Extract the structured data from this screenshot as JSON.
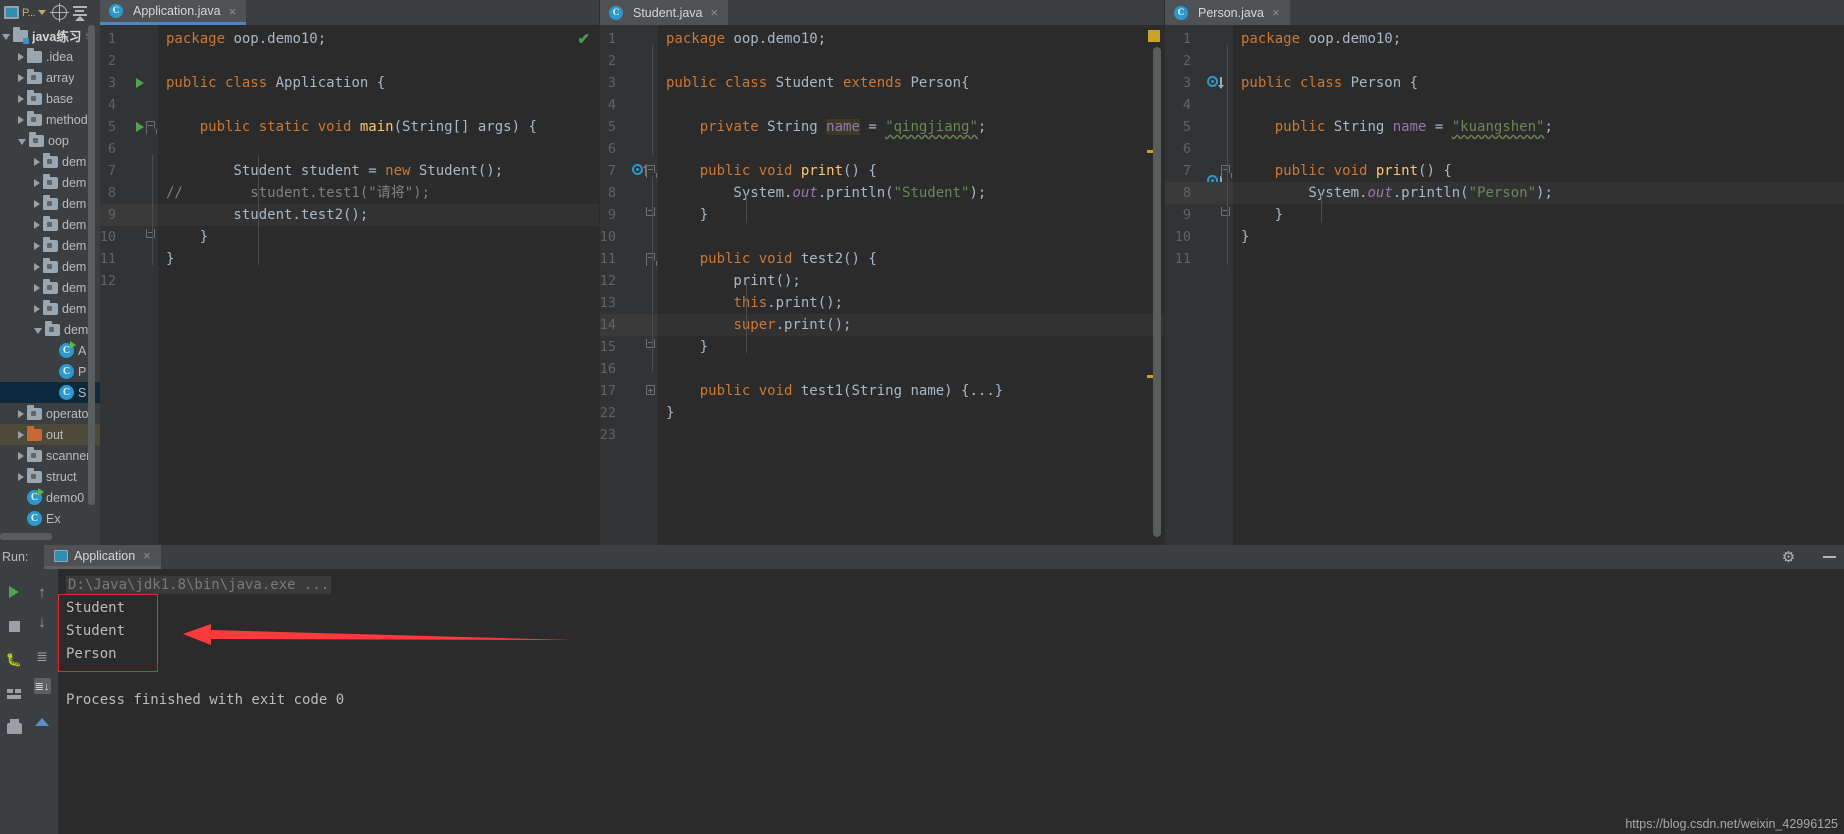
{
  "toolbar": {
    "project_label": "P...",
    "icons": [
      "project-window-icon",
      "locate-icon",
      "collapse-all-icon"
    ]
  },
  "sidebar": {
    "items": [
      {
        "label": "java练习",
        "sub": "s",
        "indent": 0,
        "state": "open",
        "icon": "module-icon",
        "bold": true
      },
      {
        "label": ".idea",
        "sub": "",
        "indent": 1,
        "state": "closed",
        "icon": "folder-icon",
        "bold": false
      },
      {
        "label": "array",
        "sub": "",
        "indent": 1,
        "state": "closed",
        "icon": "source-folder-icon",
        "bold": false
      },
      {
        "label": "base",
        "sub": "",
        "indent": 1,
        "state": "closed",
        "icon": "source-folder-icon",
        "bold": false
      },
      {
        "label": "method",
        "sub": "",
        "indent": 1,
        "state": "closed",
        "icon": "source-folder-icon",
        "bold": false
      },
      {
        "label": "oop",
        "sub": "",
        "indent": 1,
        "state": "open",
        "icon": "source-folder-icon",
        "bold": false
      },
      {
        "label": "dem",
        "sub": "",
        "indent": 2,
        "state": "closed",
        "icon": "source-folder-icon",
        "bold": false
      },
      {
        "label": "dem",
        "sub": "",
        "indent": 2,
        "state": "closed",
        "icon": "source-folder-icon",
        "bold": false
      },
      {
        "label": "dem",
        "sub": "",
        "indent": 2,
        "state": "closed",
        "icon": "source-folder-icon",
        "bold": false
      },
      {
        "label": "dem",
        "sub": "",
        "indent": 2,
        "state": "closed",
        "icon": "source-folder-icon",
        "bold": false
      },
      {
        "label": "dem",
        "sub": "",
        "indent": 2,
        "state": "closed",
        "icon": "source-folder-icon",
        "bold": false
      },
      {
        "label": "dem",
        "sub": "",
        "indent": 2,
        "state": "closed",
        "icon": "source-folder-icon",
        "bold": false
      },
      {
        "label": "dem",
        "sub": "",
        "indent": 2,
        "state": "closed",
        "icon": "source-folder-icon",
        "bold": false
      },
      {
        "label": "dem",
        "sub": "",
        "indent": 2,
        "state": "closed",
        "icon": "source-folder-icon",
        "bold": false
      },
      {
        "label": "dem",
        "sub": "",
        "indent": 2,
        "state": "open",
        "icon": "source-folder-icon",
        "bold": false
      },
      {
        "label": "A",
        "sub": "",
        "indent": 3,
        "state": "leaf",
        "icon": "runnable-class-icon",
        "bold": false
      },
      {
        "label": "P",
        "sub": "",
        "indent": 3,
        "state": "leaf",
        "icon": "class-icon",
        "bold": false
      },
      {
        "label": "S",
        "sub": "",
        "indent": 3,
        "state": "leaf",
        "icon": "class-icon",
        "bold": false,
        "selected": true
      },
      {
        "label": "operato",
        "sub": "",
        "indent": 1,
        "state": "closed",
        "icon": "source-folder-icon",
        "bold": false
      },
      {
        "label": "out",
        "sub": "",
        "indent": 1,
        "state": "closed",
        "icon": "excluded-folder-icon",
        "bold": false,
        "highlight": true
      },
      {
        "label": "scanner",
        "sub": "",
        "indent": 1,
        "state": "closed",
        "icon": "source-folder-icon",
        "bold": false
      },
      {
        "label": "struct",
        "sub": "",
        "indent": 1,
        "state": "closed",
        "icon": "source-folder-icon",
        "bold": false
      },
      {
        "label": "demo0",
        "sub": "",
        "indent": 1,
        "state": "leaf",
        "icon": "runnable-class-icon",
        "bold": false
      },
      {
        "label": "Ex",
        "sub": "",
        "indent": 1,
        "state": "leaf",
        "icon": "class-icon",
        "bold": false
      }
    ]
  },
  "editors": [
    {
      "tab": {
        "label": "Application.java",
        "icon": "class-icon",
        "close": "×",
        "active": true
      },
      "inspection_status": "ok-check",
      "lines": [
        {
          "n": 1,
          "segments": [
            {
              "t": "package",
              "c": "kw"
            },
            {
              "t": " oop.demo10;",
              "c": "id"
            }
          ]
        },
        {
          "n": 2,
          "segments": []
        },
        {
          "n": 3,
          "segments": [
            {
              "t": "public class",
              "c": "kw"
            },
            {
              "t": " Application {",
              "c": "id"
            }
          ],
          "gutter": "run"
        },
        {
          "n": 4,
          "segments": []
        },
        {
          "n": 5,
          "segments": [
            {
              "t": "    ",
              "c": "id"
            },
            {
              "t": "public static void",
              "c": "kw"
            },
            {
              "t": " ",
              "c": "id"
            },
            {
              "t": "main",
              "c": "mth"
            },
            {
              "t": "(String[] args) {",
              "c": "id"
            }
          ],
          "gutter": "run-fold"
        },
        {
          "n": 6,
          "segments": []
        },
        {
          "n": 7,
          "segments": [
            {
              "t": "        Student student = ",
              "c": "id"
            },
            {
              "t": "new",
              "c": "kw"
            },
            {
              "t": " Student();",
              "c": "id"
            }
          ]
        },
        {
          "n": 8,
          "segments": [
            {
              "t": "//",
              "c": "cmt"
            }
          ],
          "comment_prefix": true,
          "comment_text": "        student.test1(\"请将\");"
        },
        {
          "n": 9,
          "segments": [
            {
              "t": "        student.test2();",
              "c": "id"
            }
          ],
          "highlight": true
        },
        {
          "n": 10,
          "segments": [
            {
              "t": "    }",
              "c": "id"
            }
          ],
          "gutter": "fold-end"
        },
        {
          "n": 11,
          "segments": [
            {
              "t": "}",
              "c": "id"
            }
          ]
        },
        {
          "n": 12,
          "segments": []
        }
      ]
    },
    {
      "tab": {
        "label": "Student.java",
        "icon": "class-icon",
        "close": "×",
        "active": false
      },
      "lines": [
        {
          "n": 1,
          "segments": [
            {
              "t": "package",
              "c": "kw"
            },
            {
              "t": " oop.demo10;",
              "c": "id"
            }
          ]
        },
        {
          "n": 2,
          "segments": []
        },
        {
          "n": 3,
          "segments": [
            {
              "t": "public class",
              "c": "kw"
            },
            {
              "t": " Student ",
              "c": "id"
            },
            {
              "t": "extends",
              "c": "kw"
            },
            {
              "t": " Person{",
              "c": "id"
            }
          ]
        },
        {
          "n": 4,
          "segments": []
        },
        {
          "n": 5,
          "segments": [
            {
              "t": "    ",
              "c": "id"
            },
            {
              "t": "private",
              "c": "kw"
            },
            {
              "t": " String ",
              "c": "id"
            },
            {
              "t": "name",
              "c": "namehl"
            },
            {
              "t": " = ",
              "c": "id"
            },
            {
              "t": "\"qingjiang\"",
              "c": "strwavy"
            },
            {
              "t": ";",
              "c": "id"
            }
          ]
        },
        {
          "n": 6,
          "segments": []
        },
        {
          "n": 7,
          "segments": [
            {
              "t": "    ",
              "c": "id"
            },
            {
              "t": "public void",
              "c": "kw"
            },
            {
              "t": " ",
              "c": "id"
            },
            {
              "t": "print",
              "c": "mth"
            },
            {
              "t": "() {",
              "c": "id"
            }
          ],
          "gutter": "override-up-fold"
        },
        {
          "n": 8,
          "segments": [
            {
              "t": "        System.",
              "c": "id"
            },
            {
              "t": "out",
              "c": "sfld"
            },
            {
              "t": ".println(",
              "c": "id"
            },
            {
              "t": "\"Student\"",
              "c": "str"
            },
            {
              "t": ");",
              "c": "id"
            }
          ]
        },
        {
          "n": 9,
          "segments": [
            {
              "t": "    }",
              "c": "id"
            }
          ],
          "gutter": "fold-end"
        },
        {
          "n": 10,
          "segments": []
        },
        {
          "n": 11,
          "segments": [
            {
              "t": "    ",
              "c": "id"
            },
            {
              "t": "public void",
              "c": "kw"
            },
            {
              "t": " ",
              "c": "id"
            },
            {
              "t": "test2",
              "c": "mthgray"
            },
            {
              "t": "() {",
              "c": "id"
            }
          ],
          "gutter": "fold"
        },
        {
          "n": 12,
          "segments": [
            {
              "t": "        print();",
              "c": "id"
            }
          ]
        },
        {
          "n": 13,
          "segments": [
            {
              "t": "        ",
              "c": "id"
            },
            {
              "t": "this",
              "c": "kw"
            },
            {
              "t": ".print();",
              "c": "id"
            }
          ]
        },
        {
          "n": 14,
          "segments": [
            {
              "t": "        ",
              "c": "id"
            },
            {
              "t": "super",
              "c": "kw"
            },
            {
              "t": ".print();",
              "c": "id"
            }
          ],
          "highlight": true
        },
        {
          "n": 15,
          "segments": [
            {
              "t": "    }",
              "c": "id"
            }
          ],
          "gutter": "fold-end"
        },
        {
          "n": 16,
          "segments": []
        },
        {
          "n": 17,
          "segments": [
            {
              "t": "    ",
              "c": "id"
            },
            {
              "t": "public void",
              "c": "kw"
            },
            {
              "t": " ",
              "c": "id"
            },
            {
              "t": "test1",
              "c": "mthgray"
            },
            {
              "t": "(String name) ",
              "c": "id"
            },
            {
              "t": "{...}",
              "c": "folded"
            }
          ],
          "gutter": "fold-plus"
        },
        {
          "n": 22,
          "segments": [
            {
              "t": "}",
              "c": "id"
            }
          ]
        },
        {
          "n": 23,
          "segments": []
        }
      ]
    },
    {
      "tab": {
        "label": "Person.java",
        "icon": "class-icon",
        "close": "×",
        "active": false
      },
      "lines": [
        {
          "n": 1,
          "segments": [
            {
              "t": "package",
              "c": "kw"
            },
            {
              "t": " oop.demo10;",
              "c": "id"
            }
          ]
        },
        {
          "n": 2,
          "segments": []
        },
        {
          "n": 3,
          "segments": [
            {
              "t": "public class",
              "c": "kw"
            },
            {
              "t": " Person {",
              "c": "id"
            }
          ],
          "gutter": "override-down"
        },
        {
          "n": 4,
          "segments": []
        },
        {
          "n": 5,
          "segments": [
            {
              "t": "    ",
              "c": "id"
            },
            {
              "t": "public",
              "c": "kw"
            },
            {
              "t": " String ",
              "c": "id"
            },
            {
              "t": "name",
              "c": "fld"
            },
            {
              "t": " = ",
              "c": "id"
            },
            {
              "t": "\"kuangshen\"",
              "c": "strwavy"
            },
            {
              "t": ";",
              "c": "id"
            }
          ]
        },
        {
          "n": 6,
          "segments": []
        },
        {
          "n": 7,
          "segments": [
            {
              "t": "    ",
              "c": "id"
            },
            {
              "t": "public void",
              "c": "kw"
            },
            {
              "t": " ",
              "c": "id"
            },
            {
              "t": "print",
              "c": "mth"
            },
            {
              "t": "() {",
              "c": "id"
            }
          ],
          "gutter": "override-down-fold"
        },
        {
          "n": 8,
          "segments": [
            {
              "t": "        System.",
              "c": "id"
            },
            {
              "t": "out",
              "c": "sfld"
            },
            {
              "t": ".println(",
              "c": "id"
            },
            {
              "t": "\"Person\"",
              "c": "str"
            },
            {
              "t": ");",
              "c": "id"
            }
          ],
          "highlight": true
        },
        {
          "n": 9,
          "segments": [
            {
              "t": "    }",
              "c": "id"
            }
          ],
          "gutter": "fold-end"
        },
        {
          "n": 10,
          "segments": [
            {
              "t": "}",
              "c": "id"
            }
          ]
        },
        {
          "n": 11,
          "segments": []
        }
      ]
    }
  ],
  "run_panel": {
    "label": "Run:",
    "tab_label": "Application",
    "tab_close": "×",
    "gear_icon": "settings-gear-icon",
    "minimize_icon": "minimize-icon",
    "toolbar_icons": [
      "rerun-play-icon",
      "stop-icon",
      "debugger-icon",
      "show-console-icon",
      "scroll-up-icon",
      "scroll-down-icon",
      "soft-wrap-icon",
      "scroll-to-end-icon",
      "print-grid-icon",
      "print-icon",
      "expand-up-icon"
    ],
    "console": {
      "command": "D:\\Java\\jdk1.8\\bin\\java.exe ...",
      "output": [
        "Student",
        "Student",
        "Person"
      ],
      "exit_line": "Process finished with exit code 0"
    }
  },
  "annotation": {
    "box_color": "#e8242c",
    "arrow_color": "#fb3b3b"
  },
  "watermark": "https://blog.csdn.net/weixin_42996125"
}
